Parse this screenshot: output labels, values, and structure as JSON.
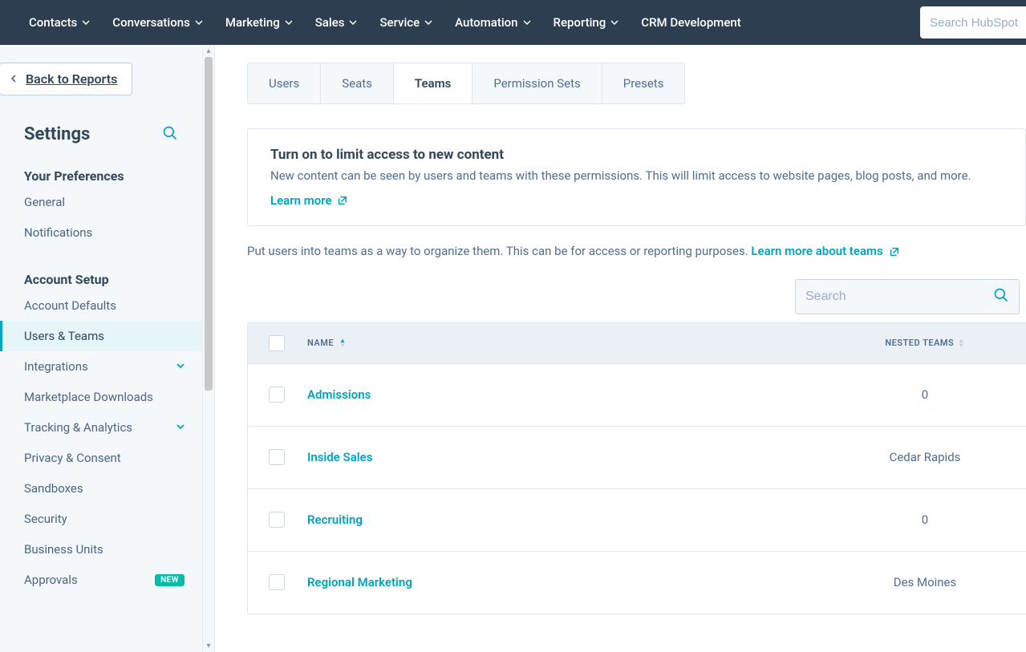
{
  "topnav": {
    "items": [
      "Contacts",
      "Conversations",
      "Marketing",
      "Sales",
      "Service",
      "Automation",
      "Reporting",
      "CRM Development"
    ],
    "search_placeholder": "Search HubSpot"
  },
  "sidebar": {
    "back_label": "Back to Reports",
    "title": "Settings",
    "sections": {
      "preferences": {
        "heading": "Your Preferences",
        "items": [
          {
            "label": "General"
          },
          {
            "label": "Notifications"
          }
        ]
      },
      "account": {
        "heading": "Account Setup",
        "items": [
          {
            "label": "Account Defaults"
          },
          {
            "label": "Users & Teams",
            "active": true
          },
          {
            "label": "Integrations",
            "expandable": true
          },
          {
            "label": "Marketplace Downloads"
          },
          {
            "label": "Tracking & Analytics",
            "expandable": true
          },
          {
            "label": "Privacy & Consent"
          },
          {
            "label": "Sandboxes"
          },
          {
            "label": "Security"
          },
          {
            "label": "Business Units"
          },
          {
            "label": "Approvals",
            "badge": "NEW"
          }
        ]
      }
    }
  },
  "content": {
    "tabs": [
      {
        "label": "Users"
      },
      {
        "label": "Seats"
      },
      {
        "label": "Teams",
        "active": true
      },
      {
        "label": "Permission Sets"
      },
      {
        "label": "Presets"
      }
    ],
    "notice": {
      "title": "Turn on to limit access to new content",
      "desc": "New content can be seen by users and teams with these permissions. This will limit access to website pages, blog posts, and more.",
      "learn": "Learn more"
    },
    "description_text": "Put users into teams as a way to organize them. This can be for access or reporting purposes. ",
    "description_link": "Learn more about teams",
    "search_placeholder": "Search",
    "table": {
      "cols": {
        "name": "NAME",
        "nested": "NESTED TEAMS"
      },
      "rows": [
        {
          "name": "Admissions",
          "nested": "0"
        },
        {
          "name": "Inside Sales",
          "nested": "Cedar Rapids"
        },
        {
          "name": "Recruiting",
          "nested": "0"
        },
        {
          "name": "Regional Marketing",
          "nested": "Des Moines"
        }
      ]
    }
  }
}
